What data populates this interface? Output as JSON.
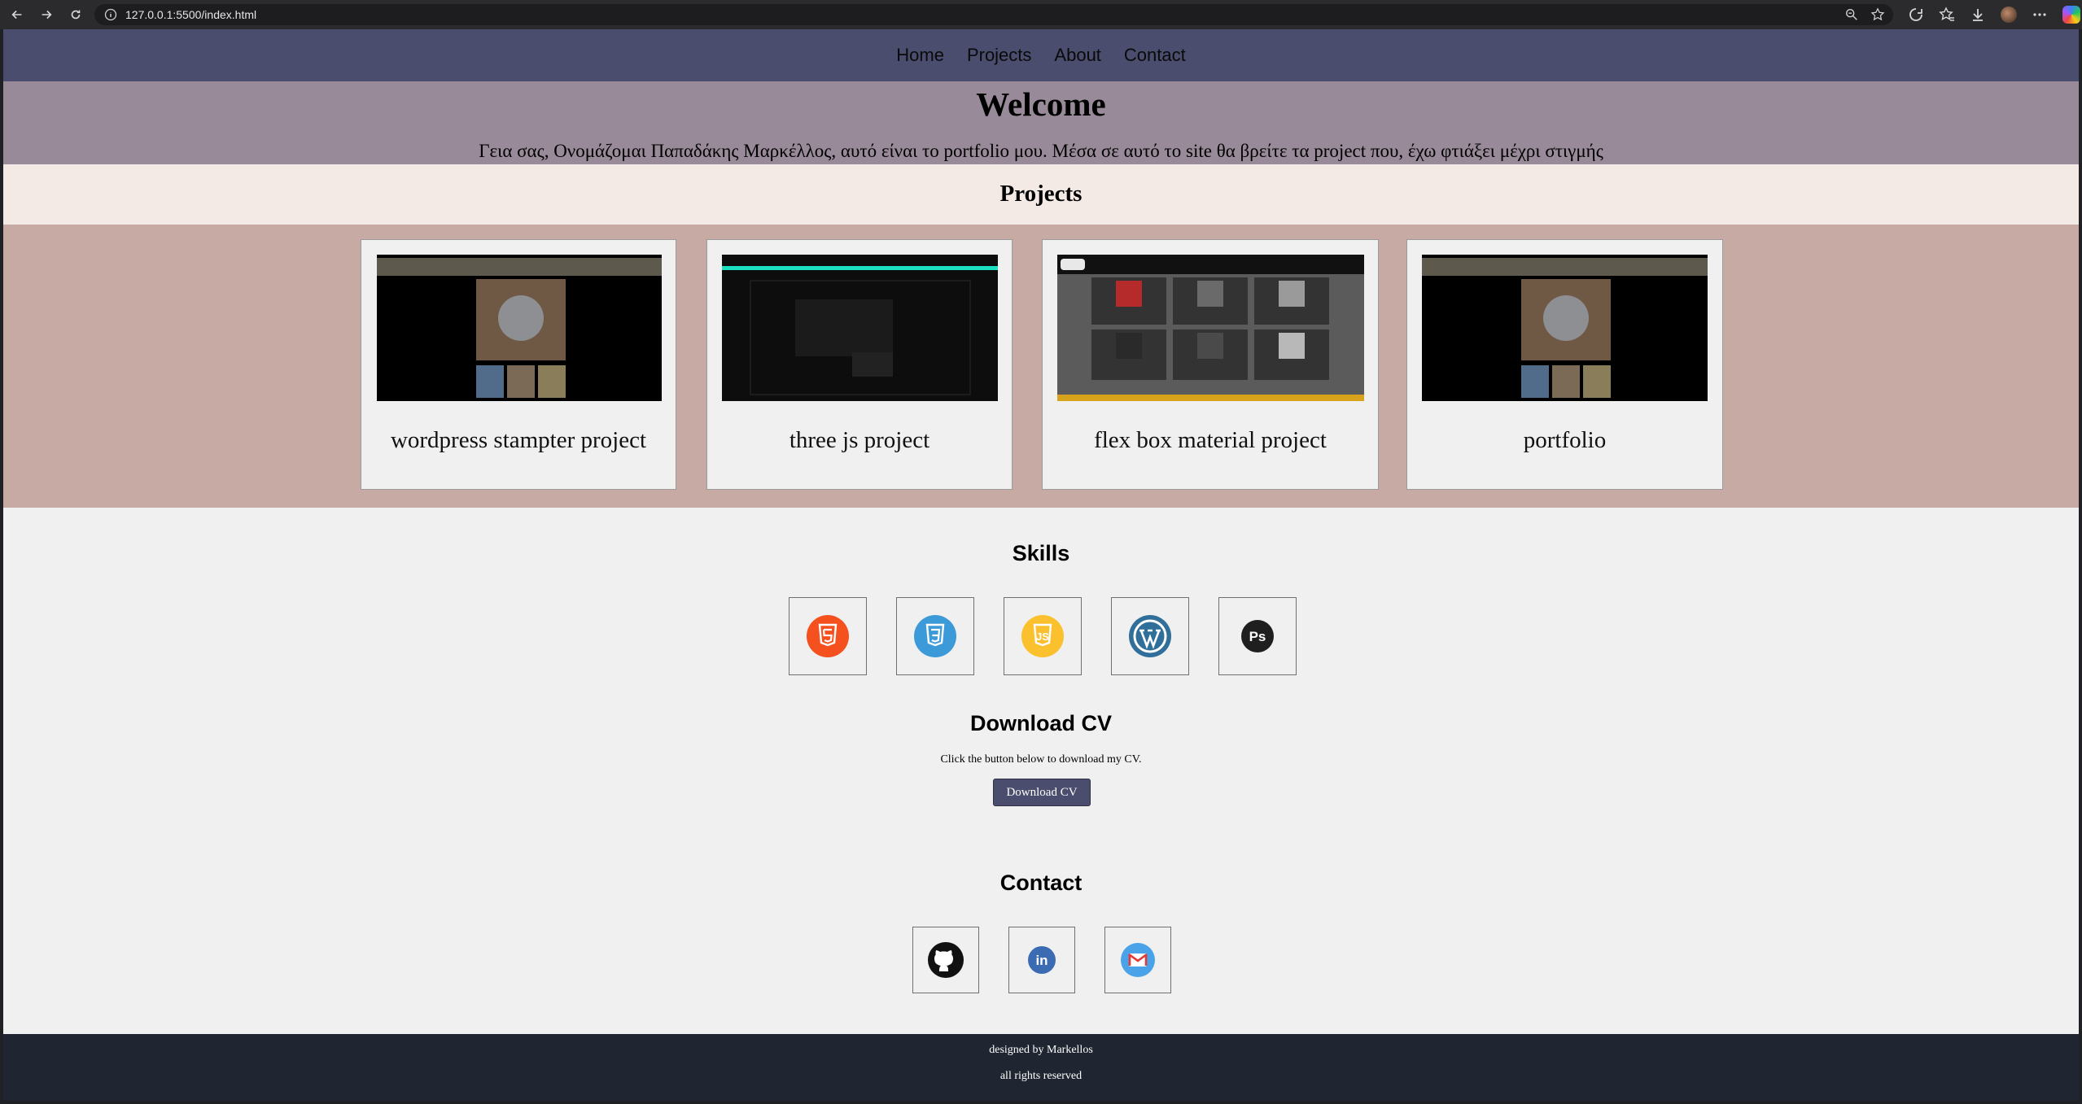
{
  "browser": {
    "url": "127.0.0.1:5500/index.html"
  },
  "nav": {
    "items": [
      "Home",
      "Projects",
      "About",
      "Contact"
    ]
  },
  "hero": {
    "title": "Welcome",
    "intro": "Γεια σας, Ονομάζομαι Παπαδάκης Μαρκέλλος, αυτό είναι το portfolio μου. Μέσα σε αυτό το site θα βρείτε τα project που, έχω φτιάξει μέχρι στιγμής"
  },
  "projects": {
    "heading": "Projects",
    "cards": [
      {
        "title": "wordpress stampter project"
      },
      {
        "title": "three js project"
      },
      {
        "title": "flex box material project"
      },
      {
        "title": "portfolio"
      }
    ]
  },
  "skills": {
    "heading": "Skills",
    "icons": [
      "html5-icon",
      "css3-icon",
      "javascript-icon",
      "wordpress-icon",
      "photoshop-icon"
    ],
    "ps_label": "Ps",
    "js_label": "JS"
  },
  "cv": {
    "heading": "Download CV",
    "text": "Click the button below to download my CV.",
    "button": "Download CV"
  },
  "contact": {
    "heading": "Contact",
    "icons": [
      "github-icon",
      "linkedin-icon",
      "gmail-icon"
    ],
    "linkedin_label": "in"
  },
  "footer": {
    "line1": "designed by Markellos",
    "line2": "all rights reserved"
  },
  "colors": {
    "nav_bg": "#4a4d6d",
    "hero_bg": "#988a98",
    "projects_head_bg": "#f3e9e5",
    "projects_band_bg": "#c7aaa4",
    "page_bg": "#f0f0f0",
    "footer_bg": "#1f2631"
  }
}
